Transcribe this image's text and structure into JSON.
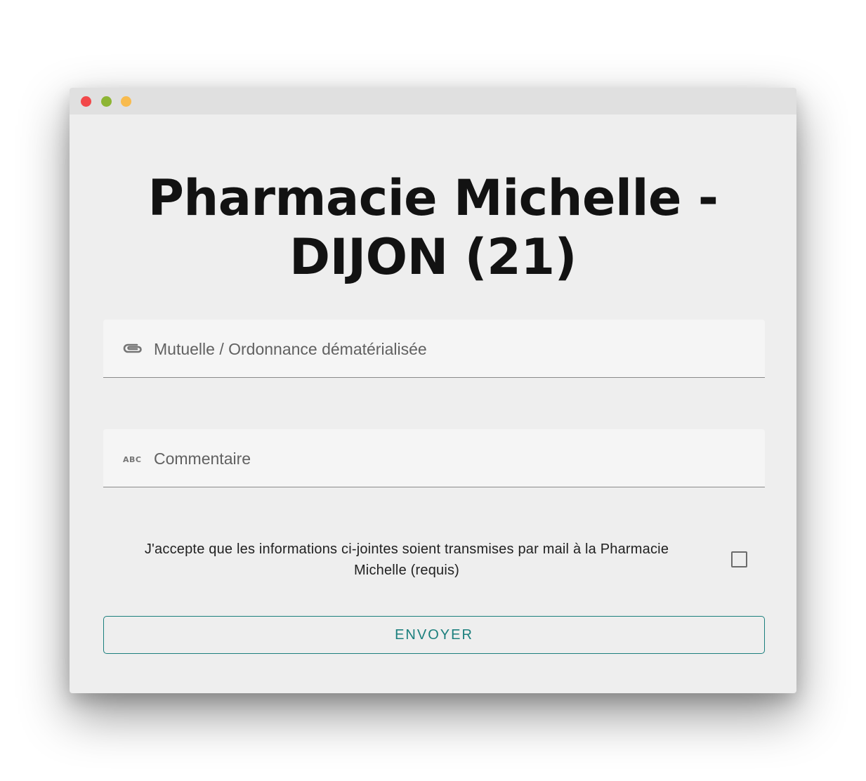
{
  "window": {
    "controls": [
      "close",
      "minimize",
      "maximize"
    ]
  },
  "page": {
    "title_line1": "Pharmacie Michelle -",
    "title_line2": "DIJON (21)"
  },
  "form": {
    "attachment_field": {
      "icon": "paperclip-icon",
      "label": "Mutuelle / Ordonnance dématérialisée"
    },
    "comment_field": {
      "icon": "abc-icon",
      "label": "Commentaire"
    },
    "consent": {
      "text": "J'accepte que les informations ci-jointes soient transmises par mail à la Pharmacie Michelle (requis)",
      "checked": false
    },
    "submit_label": "ENVOYER"
  },
  "colors": {
    "accent": "#1b7f7d",
    "close": "#f2484a",
    "minimize": "#8db534",
    "maximize": "#f8bb4e"
  }
}
